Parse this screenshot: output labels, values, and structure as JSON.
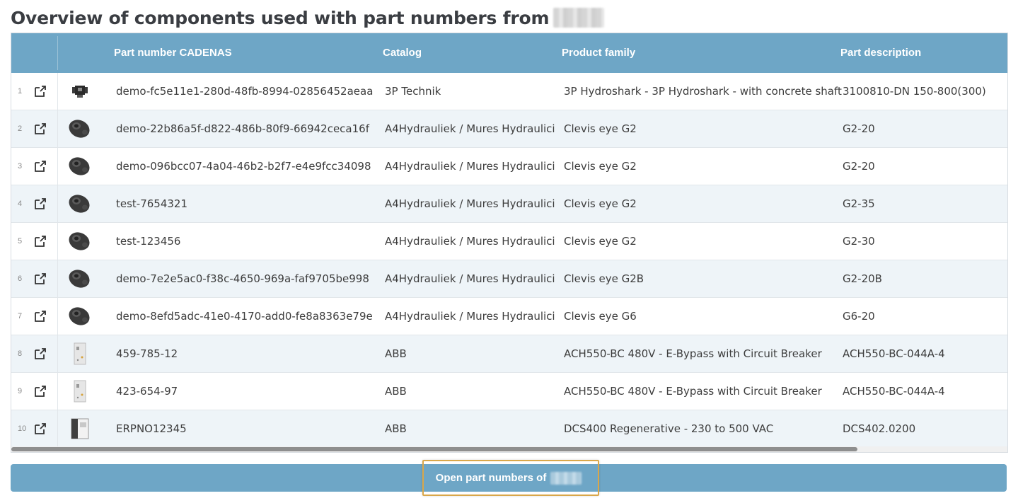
{
  "page": {
    "title": "Overview of components used with part numbers from"
  },
  "table": {
    "columns": {
      "part_number": "Part number CADENAS",
      "catalog": "Catalog",
      "product_family": "Product family",
      "part_description": "Part description"
    },
    "rows": [
      {
        "index": "1",
        "thumb": "dark-part-thumbnail",
        "part_number": "demo-fc5e11e1-280d-48fb-8994-02856452aeaa",
        "catalog": "3P Technik",
        "product_family": "3P Hydroshark - 3P Hydroshark - with concrete shaft",
        "part_description": "3100810-DN 150-800(300)"
      },
      {
        "index": "2",
        "thumb": "clevis-eye-thumbnail",
        "part_number": "demo-22b86a5f-d822-486b-80f9-66942ceca16f",
        "catalog": "A4Hydrauliek / Mures Hydraulici",
        "product_family": "Clevis eye G2",
        "part_description": "G2-20"
      },
      {
        "index": "3",
        "thumb": "clevis-eye-thumbnail",
        "part_number": "demo-096bcc07-4a04-46b2-b2f7-e4e9fcc34098",
        "catalog": "A4Hydrauliek / Mures Hydraulici",
        "product_family": "Clevis eye G2",
        "part_description": "G2-20"
      },
      {
        "index": "4",
        "thumb": "clevis-eye-thumbnail",
        "part_number": "test-7654321",
        "catalog": "A4Hydrauliek / Mures Hydraulici",
        "product_family": "Clevis eye G2",
        "part_description": "G2-35"
      },
      {
        "index": "5",
        "thumb": "clevis-eye-thumbnail",
        "part_number": "test-123456",
        "catalog": "A4Hydrauliek / Mures Hydraulici",
        "product_family": "Clevis eye G2",
        "part_description": "G2-30"
      },
      {
        "index": "6",
        "thumb": "clevis-eye-thumbnail",
        "part_number": "demo-7e2e5ac0-f38c-4650-969a-faf9705be998",
        "catalog": "A4Hydrauliek / Mures Hydraulici",
        "product_family": "Clevis eye G2B",
        "part_description": "G2-20B"
      },
      {
        "index": "7",
        "thumb": "clevis-eye-thumbnail",
        "part_number": "demo-8efd5adc-41e0-4170-add0-fe8a8363e79e",
        "catalog": "A4Hydrauliek / Mures Hydraulici",
        "product_family": "Clevis eye G6",
        "part_description": "G6-20"
      },
      {
        "index": "8",
        "thumb": "cabinet-thumbnail",
        "part_number": "459-785-12",
        "catalog": "ABB",
        "product_family": "ACH550-BC 480V - E-Bypass with Circuit Breaker",
        "part_description": "ACH550-BC-044A-4"
      },
      {
        "index": "9",
        "thumb": "cabinet-thumbnail",
        "part_number": "423-654-97",
        "catalog": "ABB",
        "product_family": "ACH550-BC 480V - E-Bypass with Circuit Breaker",
        "part_description": "ACH550-BC-044A-4"
      },
      {
        "index": "10",
        "thumb": "drive-thumbnail",
        "part_number": "ERPNO12345",
        "catalog": "ABB",
        "product_family": "DCS400 Regenerative - 230 to 500 VAC",
        "part_description": "DCS402.0200"
      }
    ]
  },
  "actions": {
    "open_button_label": "Open part numbers of"
  },
  "icons": {
    "open_external": "open-external-icon"
  },
  "colors": {
    "header_bg": "#6ea6c6",
    "focus_ring": "#d9a74a",
    "alt_row": "#eef4f8"
  }
}
